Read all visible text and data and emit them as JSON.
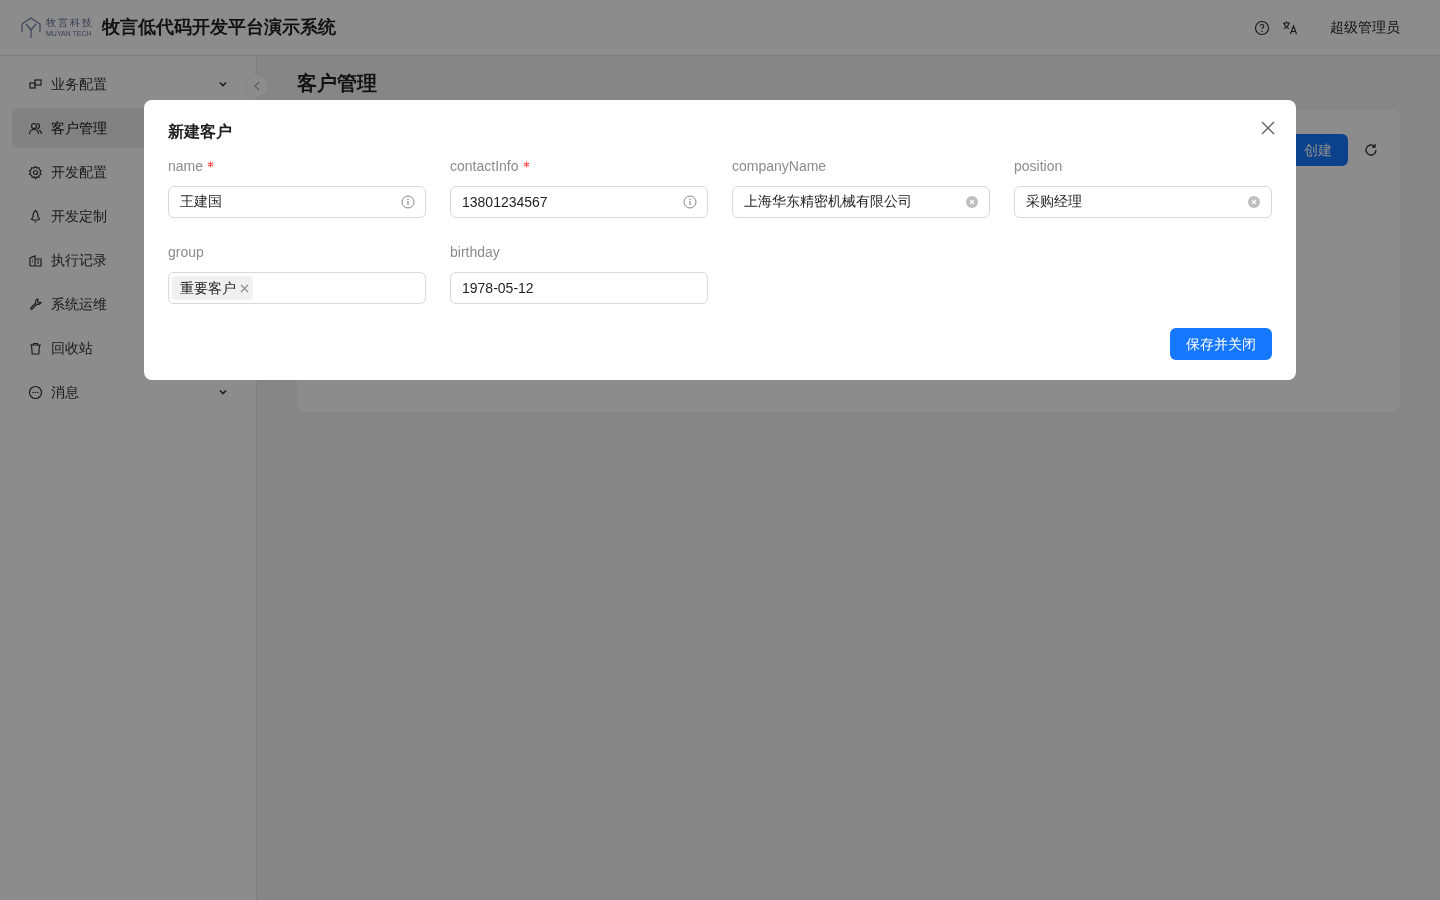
{
  "header": {
    "logo_cn": "牧言科技",
    "logo_en": "MUYAN TECH",
    "title": "牧言低代码开发平台演示系统",
    "user": "超级管理员"
  },
  "sidebar": {
    "items": [
      {
        "label": "业务配置",
        "expandable": true,
        "selected": false
      },
      {
        "label": "客户管理",
        "expandable": false,
        "selected": true
      },
      {
        "label": "开发配置",
        "expandable": false,
        "selected": false
      },
      {
        "label": "开发定制",
        "expandable": false,
        "selected": false
      },
      {
        "label": "执行记录",
        "expandable": false,
        "selected": false
      },
      {
        "label": "系统运维",
        "expandable": false,
        "selected": false
      },
      {
        "label": "回收站",
        "expandable": false,
        "selected": false
      },
      {
        "label": "消息",
        "expandable": true,
        "selected": false
      }
    ]
  },
  "page": {
    "title": "客户管理",
    "create_button": "创建"
  },
  "dialog": {
    "title": "新建客户",
    "fields": [
      {
        "label": "name",
        "required": true,
        "kind": "text",
        "value": "王建国",
        "tooltip": true,
        "clearable": false
      },
      {
        "label": "contactInfo",
        "required": true,
        "kind": "text",
        "value": "13801234567",
        "tooltip": true,
        "clearable": false
      },
      {
        "label": "companyName",
        "required": false,
        "kind": "text",
        "value": "上海华东精密机械有限公司",
        "tooltip": false,
        "clearable": true
      },
      {
        "label": "position",
        "required": false,
        "kind": "text",
        "value": "采购经理",
        "tooltip": false,
        "clearable": true
      },
      {
        "label": "group",
        "required": false,
        "kind": "tags",
        "tags": [
          "重要客户"
        ]
      },
      {
        "label": "birthday",
        "required": false,
        "kind": "text",
        "value": "1978-05-12",
        "tooltip": false,
        "clearable": false
      }
    ],
    "save_button": "保存并关闭"
  }
}
